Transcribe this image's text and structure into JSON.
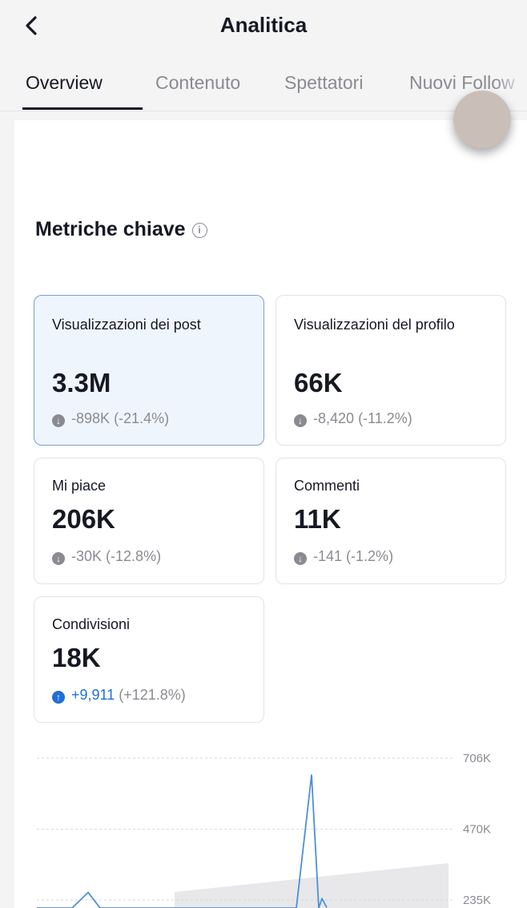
{
  "header": {
    "title": "Analitica",
    "back_icon": "chevron-left-icon"
  },
  "tabs": [
    {
      "label": "Overview",
      "active": true
    },
    {
      "label": "Contenuto",
      "active": false
    },
    {
      "label": "Spettatori",
      "active": false
    },
    {
      "label": "Nuovi Follow",
      "active": false
    }
  ],
  "metrics": {
    "title": "Metriche chiave",
    "info_icon": "info-icon",
    "cards": [
      {
        "label": "Visualizzazioni dei post",
        "value": "3.3M",
        "delta_num": "-898K",
        "delta_pct": "(-21.4%)",
        "direction": "down",
        "selected": true
      },
      {
        "label": "Visualizzazioni del profilo",
        "value": "66K",
        "delta_num": "-8,420",
        "delta_pct": "(-11.2%)",
        "direction": "down",
        "selected": false
      },
      {
        "label": "Mi piace",
        "value": "206K",
        "delta_num": "-30K",
        "delta_pct": "(-12.8%)",
        "direction": "down",
        "selected": false
      },
      {
        "label": "Commenti",
        "value": "11K",
        "delta_num": "-141",
        "delta_pct": "(-1.2%)",
        "direction": "down",
        "selected": false
      },
      {
        "label": "Condivisioni",
        "value": "18K",
        "delta_num": "+9,911",
        "delta_pct": "(+121.8%)",
        "direction": "up",
        "selected": false
      }
    ]
  },
  "chart_data": {
    "type": "line",
    "y_ticks": [
      "706K",
      "470K",
      "235K"
    ],
    "y_tick_values": [
      706000,
      470000,
      235000
    ],
    "series": [
      {
        "values": [
          120000,
          140000,
          160000,
          260000,
          150000,
          140000,
          130000,
          140000,
          150000,
          160000,
          200000,
          650000,
          180000,
          240000,
          210000
        ]
      }
    ],
    "line_color": "#4d8fd8"
  },
  "colors": {
    "accent": "#1f6fd6",
    "selected_card_bg": "#eff5fc",
    "selected_card_border": "#7b9ed3",
    "muted": "#8a8b91"
  }
}
